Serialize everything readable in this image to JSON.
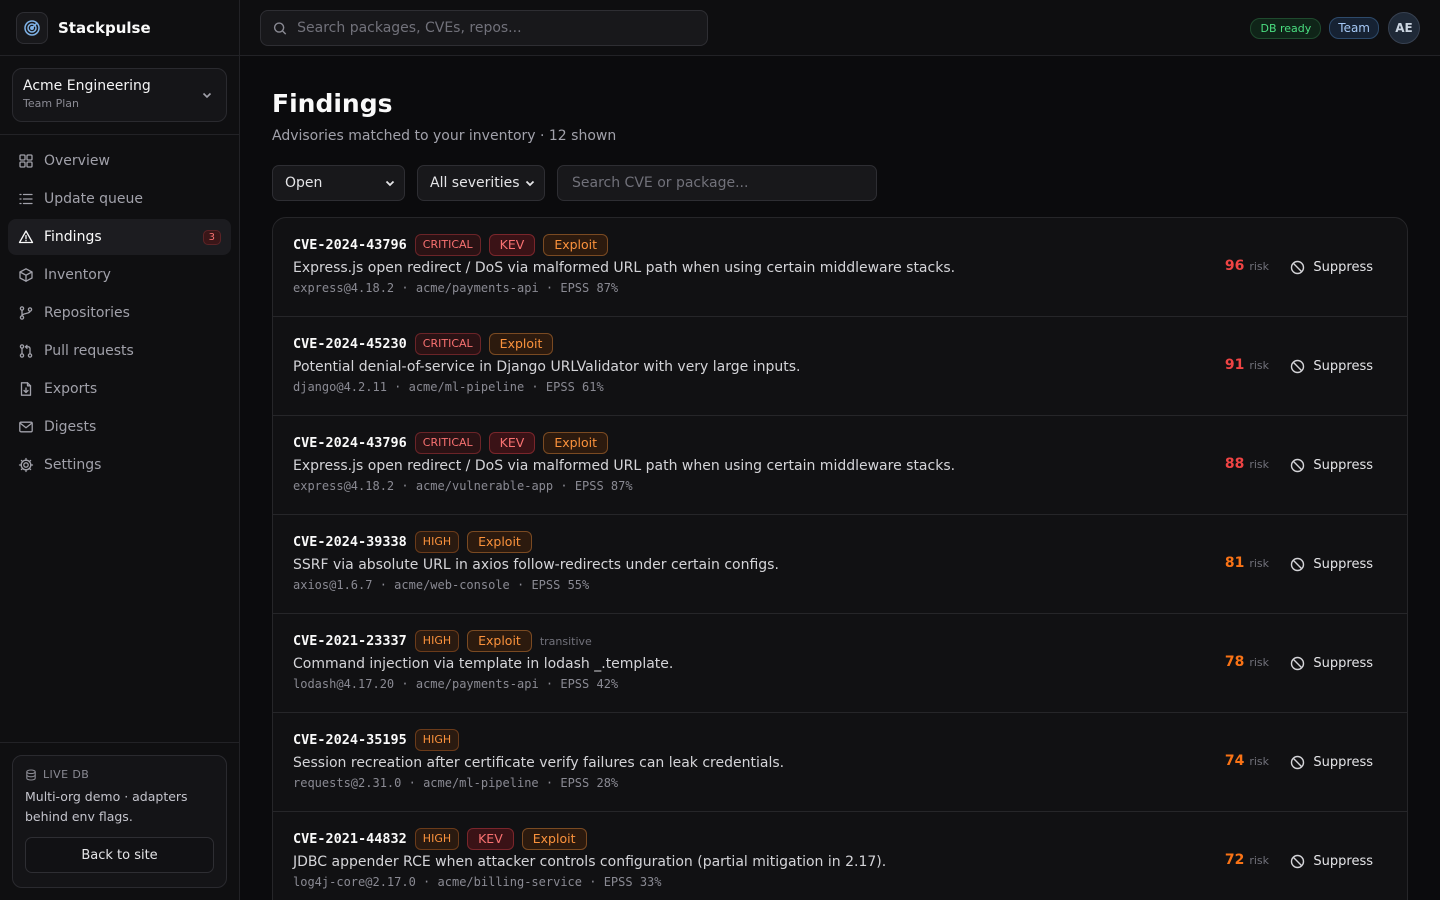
{
  "app": {
    "name": "Stackpulse"
  },
  "org": {
    "name": "Acme Engineering",
    "plan": "Team Plan"
  },
  "nav": [
    {
      "label": "Overview",
      "icon": "grid-icon"
    },
    {
      "label": "Update queue",
      "icon": "list-icon"
    },
    {
      "label": "Findings",
      "icon": "alert-triangle-icon",
      "badge": "3",
      "active": true
    },
    {
      "label": "Inventory",
      "icon": "package-icon"
    },
    {
      "label": "Repositories",
      "icon": "git-branch-icon"
    },
    {
      "label": "Pull requests",
      "icon": "git-pull-request-icon"
    },
    {
      "label": "Exports",
      "icon": "file-export-icon"
    },
    {
      "label": "Digests",
      "icon": "mail-icon"
    },
    {
      "label": "Settings",
      "icon": "gear-icon"
    }
  ],
  "footer": {
    "live_label": "LIVE DB",
    "live_text": "Multi-org demo · adapters behind env flags.",
    "back_label": "Back to site"
  },
  "topbar": {
    "search_placeholder": "Search packages, CVEs, repos...",
    "db_status": "DB ready",
    "plan_badge": "Team",
    "avatar_initials": "AE"
  },
  "page": {
    "title": "Findings",
    "subtitle": "Advisories matched to your inventory · 12 shown"
  },
  "filters": {
    "status_value": "Open",
    "severity_value": "All severities",
    "search_placeholder": "Search CVE or package..."
  },
  "colors": {
    "critical": "#ef4444",
    "high": "#f97316"
  },
  "labels": {
    "risk": "risk",
    "suppress": "Suppress",
    "kev": "KEV",
    "exploit": "Exploit"
  },
  "findings": [
    {
      "cve": "CVE-2024-43796",
      "severity": "CRITICAL",
      "kev": true,
      "exploit": true,
      "transitive": "",
      "description": "Express.js open redirect / DoS via malformed URL path when using certain middleware stacks.",
      "package": "express@4.18.2",
      "repo": "acme/payments-api",
      "epss": "EPSS 87%",
      "risk": "96"
    },
    {
      "cve": "CVE-2024-45230",
      "severity": "CRITICAL",
      "kev": false,
      "exploit": true,
      "transitive": "",
      "description": "Potential denial-of-service in Django URLValidator with very large inputs.",
      "package": "django@4.2.11",
      "repo": "acme/ml-pipeline",
      "epss": "EPSS 61%",
      "risk": "91"
    },
    {
      "cve": "CVE-2024-43796",
      "severity": "CRITICAL",
      "kev": true,
      "exploit": true,
      "transitive": "",
      "description": "Express.js open redirect / DoS via malformed URL path when using certain middleware stacks.",
      "package": "express@4.18.2",
      "repo": "acme/vulnerable-app",
      "epss": "EPSS 87%",
      "risk": "88"
    },
    {
      "cve": "CVE-2024-39338",
      "severity": "HIGH",
      "kev": false,
      "exploit": true,
      "transitive": "",
      "description": "SSRF via absolute URL in axios follow-redirects under certain configs.",
      "package": "axios@1.6.7",
      "repo": "acme/web-console",
      "epss": "EPSS 55%",
      "risk": "81"
    },
    {
      "cve": "CVE-2021-23337",
      "severity": "HIGH",
      "kev": false,
      "exploit": true,
      "transitive": "transitive",
      "description": "Command injection via template in lodash _.template.",
      "package": "lodash@4.17.20",
      "repo": "acme/payments-api",
      "epss": "EPSS 42%",
      "risk": "78"
    },
    {
      "cve": "CVE-2024-35195",
      "severity": "HIGH",
      "kev": false,
      "exploit": false,
      "transitive": "",
      "description": "Session recreation after certificate verify failures can leak credentials.",
      "package": "requests@2.31.0",
      "repo": "acme/ml-pipeline",
      "epss": "EPSS 28%",
      "risk": "74"
    },
    {
      "cve": "CVE-2021-44832",
      "severity": "HIGH",
      "kev": true,
      "exploit": true,
      "transitive": "",
      "description": "JDBC appender RCE when attacker controls configuration (partial mitigation in 2.17).",
      "package": "log4j-core@2.17.0",
      "repo": "acme/billing-service",
      "epss": "EPSS 33%",
      "risk": "72"
    }
  ]
}
